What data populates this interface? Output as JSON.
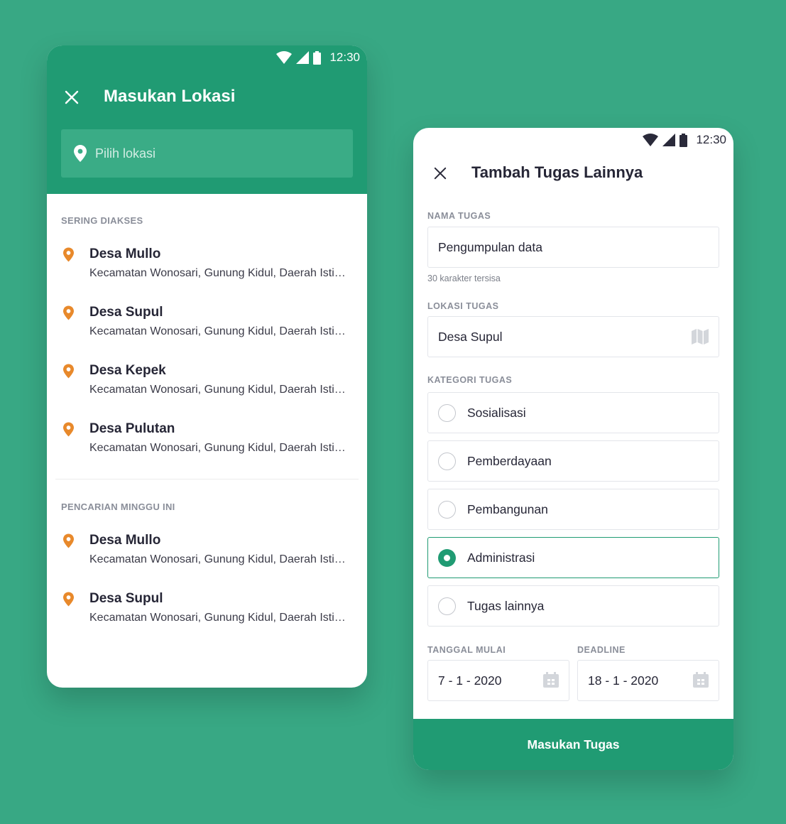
{
  "status_bar": {
    "time": "12:30"
  },
  "location_screen": {
    "title": "Masukan Lokasi",
    "search": {
      "placeholder": "Pilih lokasi"
    },
    "frequent": {
      "label": "SERING DIAKSES",
      "items": [
        {
          "name": "Desa Mullo",
          "address": "Kecamatan Wonosari, Gunung Kidul, Daerah Istimewa Yogyakarta"
        },
        {
          "name": "Desa Supul",
          "address": "Kecamatan Wonosari, Gunung Kidul, Daerah Istimewa Yogyakarta"
        },
        {
          "name": "Desa Kepek",
          "address": "Kecamatan Wonosari, Gunung Kidul, Daerah Istimewa Yogyakarta"
        },
        {
          "name": "Desa Pulutan",
          "address": "Kecamatan Wonosari, Gunung Kidul, Daerah Istimewa Yogyakarta"
        }
      ]
    },
    "recent": {
      "label": "PENCARIAN MINGGU INI",
      "items": [
        {
          "name": "Desa Mullo",
          "address": "Kecamatan Wonosari, Gunung Kidul, Daerah Istimewa Yogyakarta"
        },
        {
          "name": "Desa Supul",
          "address": "Kecamatan Wonosari, Gunung Kidul, Daerah Istimewa Yogyakarta"
        }
      ]
    }
  },
  "task_screen": {
    "title": "Tambah Tugas Lainnya",
    "task_name": {
      "label": "NAMA TUGAS",
      "value": "Pengumpulan data",
      "helper": "30 karakter tersisa"
    },
    "task_location": {
      "label": "LOKASI TUGAS",
      "value": "Desa Supul"
    },
    "category": {
      "label": "KATEGORI TUGAS",
      "selected": "Administrasi",
      "options": [
        {
          "label": "Sosialisasi"
        },
        {
          "label": "Pemberdayaan"
        },
        {
          "label": "Pembangunan"
        },
        {
          "label": "Administrasi"
        },
        {
          "label": "Tugas lainnya"
        }
      ]
    },
    "start_date": {
      "label": "TANGGAL MULAI",
      "value": "7 - 1 - 2020"
    },
    "deadline": {
      "label": "DEADLINE",
      "value": "18 - 1 - 2020"
    },
    "submit_label": "Masukan Tugas"
  },
  "colors": {
    "background": "#38a884",
    "primary": "#209b73",
    "pin": "#e8892b",
    "text": "#262636",
    "muted": "#8a8e99"
  },
  "icons": [
    "wifi-icon",
    "signal-icon",
    "battery-icon",
    "close-icon",
    "location-pin-icon",
    "map-icon",
    "calendar-icon"
  ]
}
